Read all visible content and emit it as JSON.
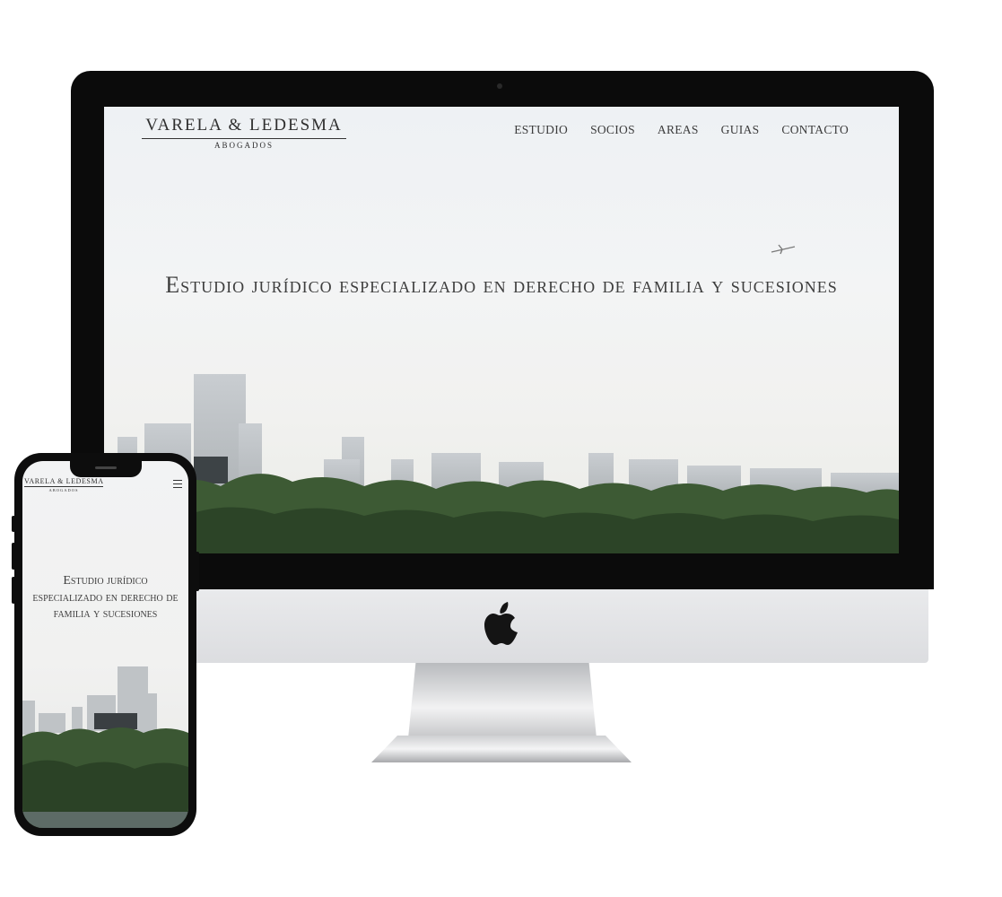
{
  "site": {
    "logo_name": "VARELA & LEDESMA",
    "logo_sub": "ABOGADOS",
    "nav": [
      "ESTUDIO",
      "SOCIOS",
      "AREAS",
      "GUIAS",
      "CONTACTO"
    ],
    "hero_title": "Estudio jurídico especializado en derecho de familia y sucesiones"
  },
  "mobile": {
    "logo_name": "VARELA & LEDESMA",
    "logo_sub": "ABOGADOS",
    "hero_title": "Estudio jurídico especializado en derecho de familia y sucesiones",
    "menu_icon": "hamburger-menu-icon"
  },
  "devices": {
    "desktop_icon": "apple-logo-icon"
  }
}
